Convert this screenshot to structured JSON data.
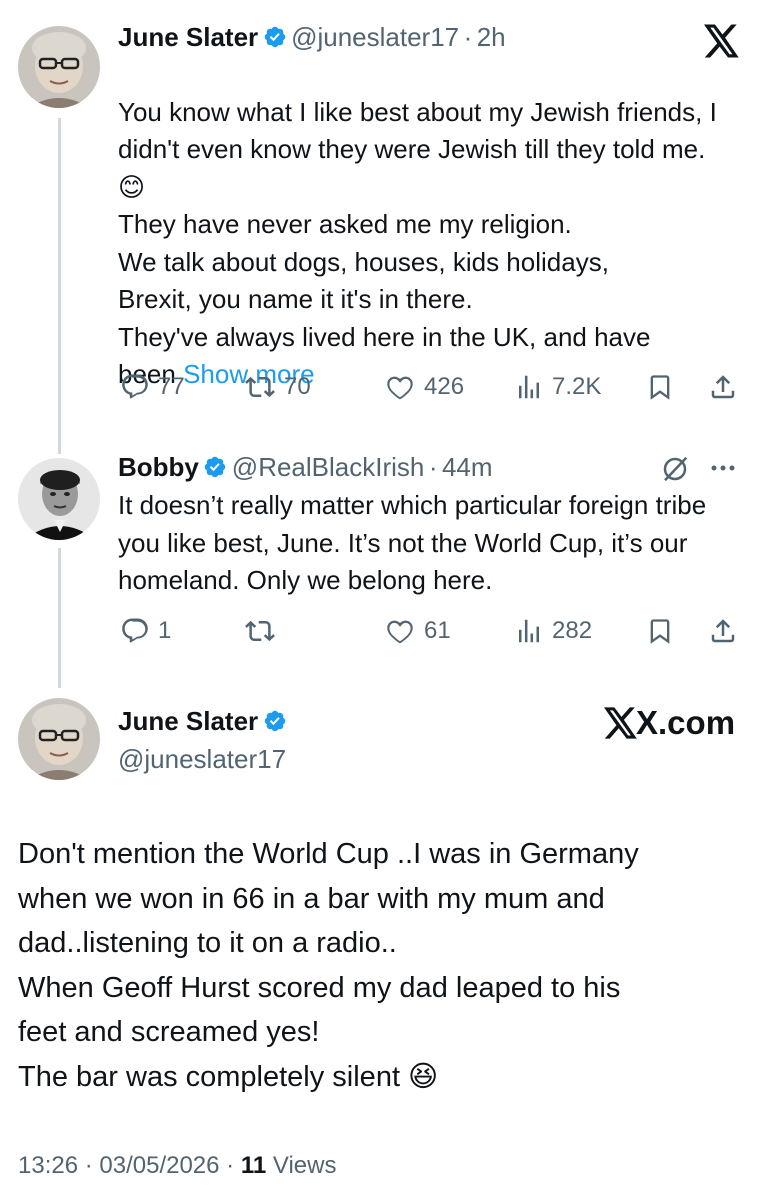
{
  "tweet1": {
    "name": "June Slater",
    "handle": "@juneslater17",
    "time": "2h",
    "text": "You know what I like best about my Jewish friends, I didn't even know they were Jewish till they told me. 😊\nThey have never asked me my religion.\n We talk about dogs,  houses, kids holidays,\nBrexit,   you name it it's in there.\nThey've always lived  here in the UK, and have\nbeen ",
    "show_more": "Show more",
    "replies": "77",
    "retweets": "70",
    "likes": "426",
    "views": "7.2K"
  },
  "tweet2": {
    "name": "Bobby",
    "handle": "@RealBlackIrish",
    "time": "44m",
    "text": "It doesn’t really matter which particular foreign tribe you like best, June. It’s not the World Cup, it’s our homeland. Only we belong here.",
    "replies": "1",
    "retweets": "",
    "likes": "61",
    "views": "282"
  },
  "tweet3": {
    "name": "June Slater",
    "handle": "@juneslater17",
    "brand": "X.com",
    "text": "Don't mention the World Cup ..I was in Germany\nwhen we won in 66 in a bar with my mum and\ndad..listening to it on a radio..\nWhen Geoff Hurst  scored my dad leaped to his\nfeet and screamed yes!\nThe bar was completely silent 😆",
    "timestamp": "13:26 · 03/05/2026 · ",
    "views_count": "11",
    "views_label": " Views"
  },
  "separator": "·",
  "colors": {
    "accent": "#1d9bf0",
    "muted": "#536471",
    "text": "#0f1419",
    "line": "#cfd9de"
  }
}
